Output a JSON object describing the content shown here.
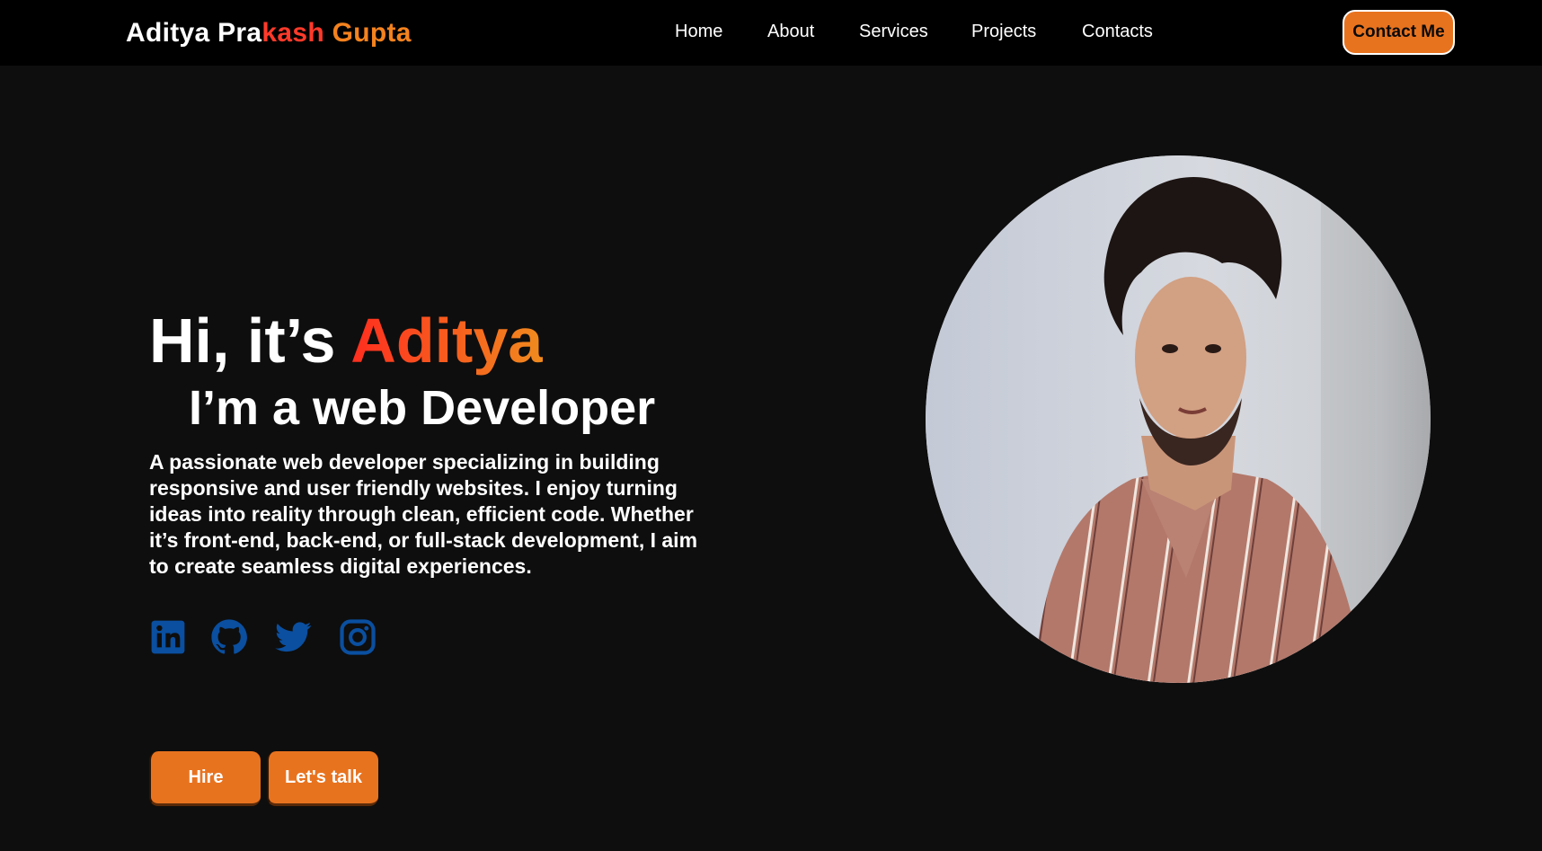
{
  "navbar": {
    "brand": {
      "part1": "Aditya Pra",
      "part2": "kash ",
      "part3": "Gupta"
    },
    "links": [
      "Home",
      "About",
      "Services",
      "Projects",
      "Contacts"
    ],
    "contact_button": "Contact Me"
  },
  "hero": {
    "greeting": "Hi, it’s ",
    "name": "Aditya",
    "subtitle": "I’m a web Developer",
    "description": "A passionate web developer specializing in building responsive and user friendly websites. I enjoy turning ideas into reality through clean, efficient code. Whether it’s front-end, back-end, or full-stack development, I aim to create seamless digital experiences.",
    "socials": [
      "linkedin-icon",
      "github-icon",
      "twitter-icon",
      "instagram-icon"
    ],
    "buttons": {
      "hire": "Hire",
      "talk": "Let's talk"
    }
  },
  "colors": {
    "background": "#0e0e0e",
    "navbar": "#000000",
    "accent_orange": "#e8731f",
    "accent_red": "#ff3a2a",
    "social_blue": "#0a4fa0"
  }
}
